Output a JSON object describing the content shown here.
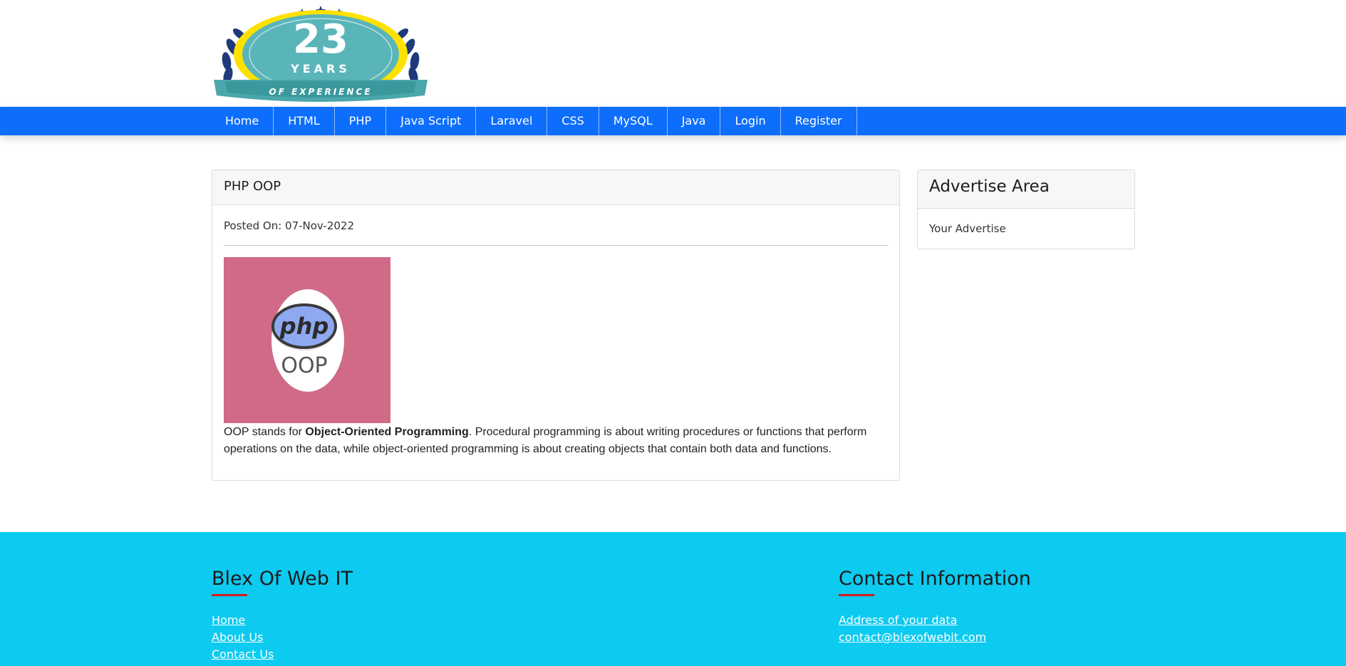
{
  "logo": {
    "number": "23",
    "years": "YEARS",
    "banner": "OF EXPERIENCE"
  },
  "nav": {
    "items": [
      "Home",
      "HTML",
      "PHP",
      "Java Script",
      "Laravel",
      "CSS",
      "MySQL",
      "Java",
      "Login",
      "Register"
    ]
  },
  "post": {
    "title": "PHP OOP",
    "posted": "Posted On: 07-Nov-2022",
    "image_text_php": "php",
    "image_text_oop": "OOP",
    "body_pre": "OOP stands for ",
    "body_bold": "Object-Oriented Programming",
    "body_post": ". Procedural programming is about writing procedures or functions that perform operations on the data, while object-oriented programming is about creating objects that contain both data and functions."
  },
  "advertise": {
    "title": "Advertise Area",
    "body": "Your Advertise"
  },
  "footer": {
    "left": {
      "title": "Blex Of Web IT",
      "links": [
        "Home",
        "About Us",
        "Contact Us"
      ]
    },
    "right": {
      "title": "Contact Information",
      "links": [
        "Address of your data",
        "contact@blexofwebit.com"
      ]
    }
  },
  "colors": {
    "nav": "#0d6efd",
    "footer": "#0dcaf0",
    "accent_bar": "#d41d1d",
    "post_image_bg": "#d06a87"
  }
}
